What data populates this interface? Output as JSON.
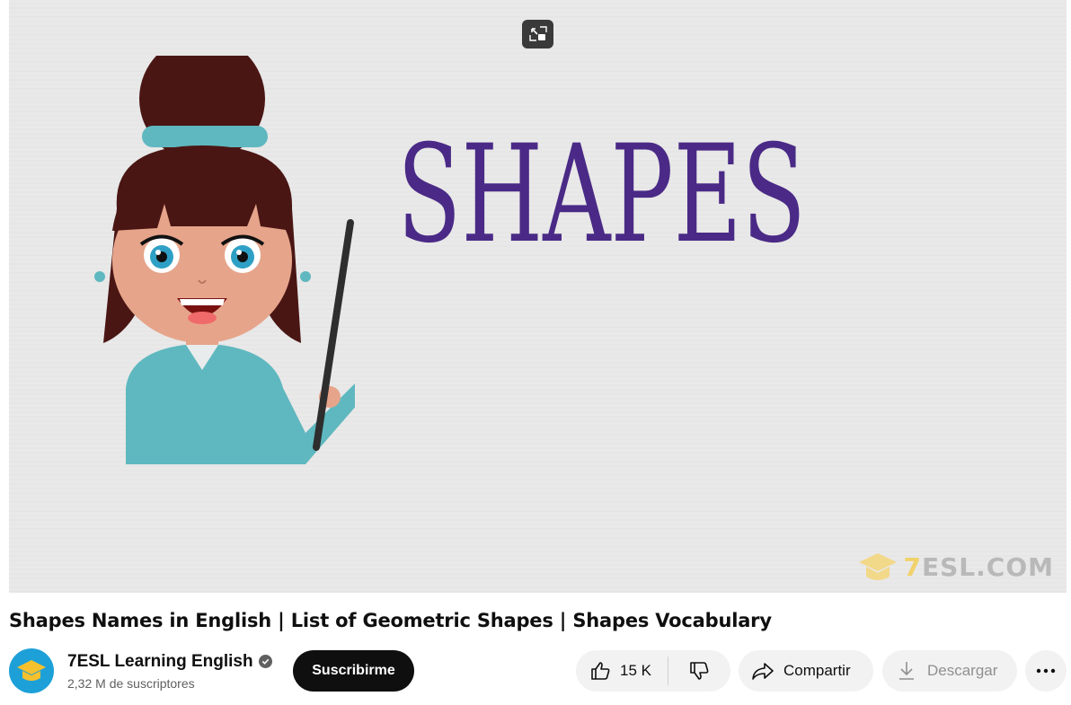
{
  "player": {
    "headline": "SHAPES",
    "watermark_prefix": "7",
    "watermark_suffix": "ESL.COM",
    "pip_icon": "exit-picture-in-picture-icon"
  },
  "video": {
    "title": "Shapes Names in English | List of Geometric Shapes | Shapes Vocabulary"
  },
  "channel": {
    "name": "7ESL Learning English",
    "subscribers": "2,32 M de suscriptores",
    "verified_icon": "verified-check-icon"
  },
  "actions": {
    "subscribe_label": "Suscribirme",
    "like_count": "15 K",
    "share_label": "Compartir",
    "download_label": "Descargar",
    "more_icon": "more-horizontal-icon"
  },
  "colors": {
    "headline": "#4a2a86",
    "subscribe_bg": "#0f0f0f",
    "pill_bg": "#f2f2f2",
    "avatar_bg": "#1da0d8"
  }
}
